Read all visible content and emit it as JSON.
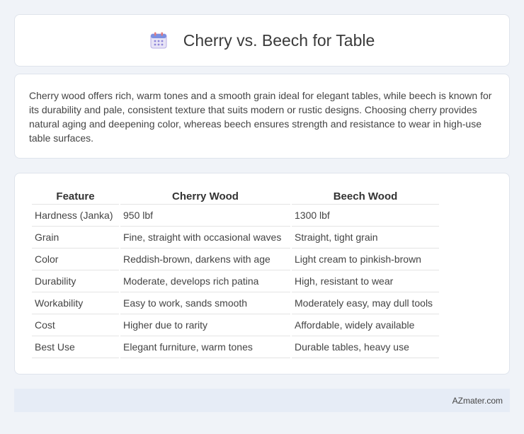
{
  "header": {
    "icon": "calendar-icon",
    "title": "Cherry vs. Beech for Table"
  },
  "intro": {
    "text": "Cherry wood offers rich, warm tones and a smooth grain ideal for elegant tables, while beech is known for its durability and pale, consistent texture that suits modern or rustic designs. Choosing cherry provides natural aging and deepening color, whereas beech ensures strength and resistance to wear in high-use table surfaces."
  },
  "table": {
    "headers": [
      "Feature",
      "Cherry Wood",
      "Beech Wood"
    ],
    "rows": [
      [
        "Hardness (Janka)",
        "950 lbf",
        "1300 lbf"
      ],
      [
        "Grain",
        "Fine, straight with occasional waves",
        "Straight, tight grain"
      ],
      [
        "Color",
        "Reddish-brown, darkens with age",
        "Light cream to pinkish-brown"
      ],
      [
        "Durability",
        "Moderate, develops rich patina",
        "High, resistant to wear"
      ],
      [
        "Workability",
        "Easy to work, sands smooth",
        "Moderately easy, may dull tools"
      ],
      [
        "Cost",
        "Higher due to rarity",
        "Affordable, widely available"
      ],
      [
        "Best Use",
        "Elegant furniture, warm tones",
        "Durable tables, heavy use"
      ]
    ]
  },
  "footer": {
    "brand": "AZmater.com"
  }
}
